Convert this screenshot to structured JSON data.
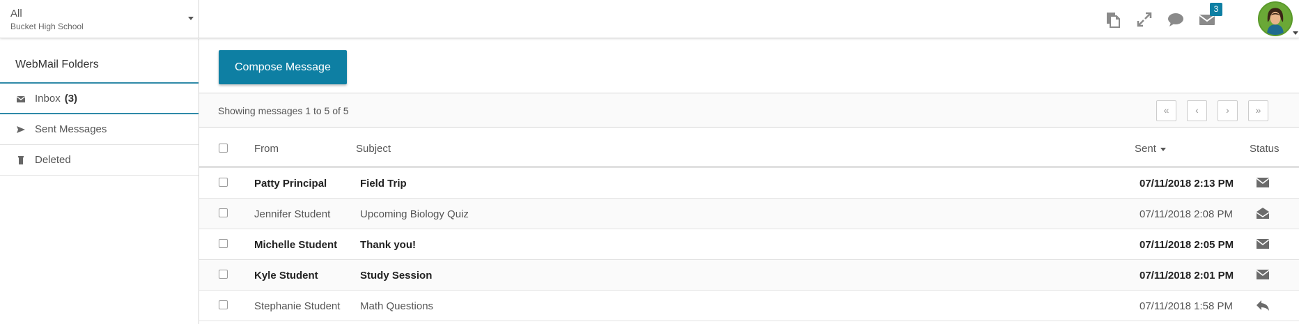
{
  "school_selector": {
    "value": "All",
    "school": "Bucket High School"
  },
  "header": {
    "notifications_count": "3"
  },
  "sidebar": {
    "title": "WebMail Folders",
    "folders": [
      {
        "label": "Inbox",
        "count": "(3)",
        "icon": "envelope-icon"
      },
      {
        "label": "Sent Messages",
        "icon": "send-icon"
      },
      {
        "label": "Deleted",
        "icon": "trash-icon"
      }
    ]
  },
  "toolbar": {
    "compose_label": "Compose Message"
  },
  "pager": {
    "summary": "Showing messages 1 to 5 of 5",
    "first": "«",
    "prev": "‹",
    "next": "›",
    "last": "»"
  },
  "table": {
    "headers": {
      "from": "From",
      "subject": "Subject",
      "sent": "Sent",
      "status": "Status"
    },
    "rows": [
      {
        "from": "Patty Principal",
        "subject": "Field Trip",
        "sent": "07/11/2018 2:13 PM",
        "status": "unread"
      },
      {
        "from": "Jennifer Student",
        "subject": "Upcoming Biology Quiz",
        "sent": "07/11/2018 2:08 PM",
        "status": "read"
      },
      {
        "from": "Michelle Student",
        "subject": "Thank you!",
        "sent": "07/11/2018 2:05 PM",
        "status": "unread"
      },
      {
        "from": "Kyle Student",
        "subject": "Study Session",
        "sent": "07/11/2018 2:01 PM",
        "status": "unread"
      },
      {
        "from": "Stephanie Student",
        "subject": "Math Questions",
        "sent": "07/11/2018 1:58 PM",
        "status": "replied"
      }
    ]
  },
  "colors": {
    "accent": "#0e7fa3",
    "border": "#d6d6d6",
    "icon": "#7a7a7a"
  }
}
